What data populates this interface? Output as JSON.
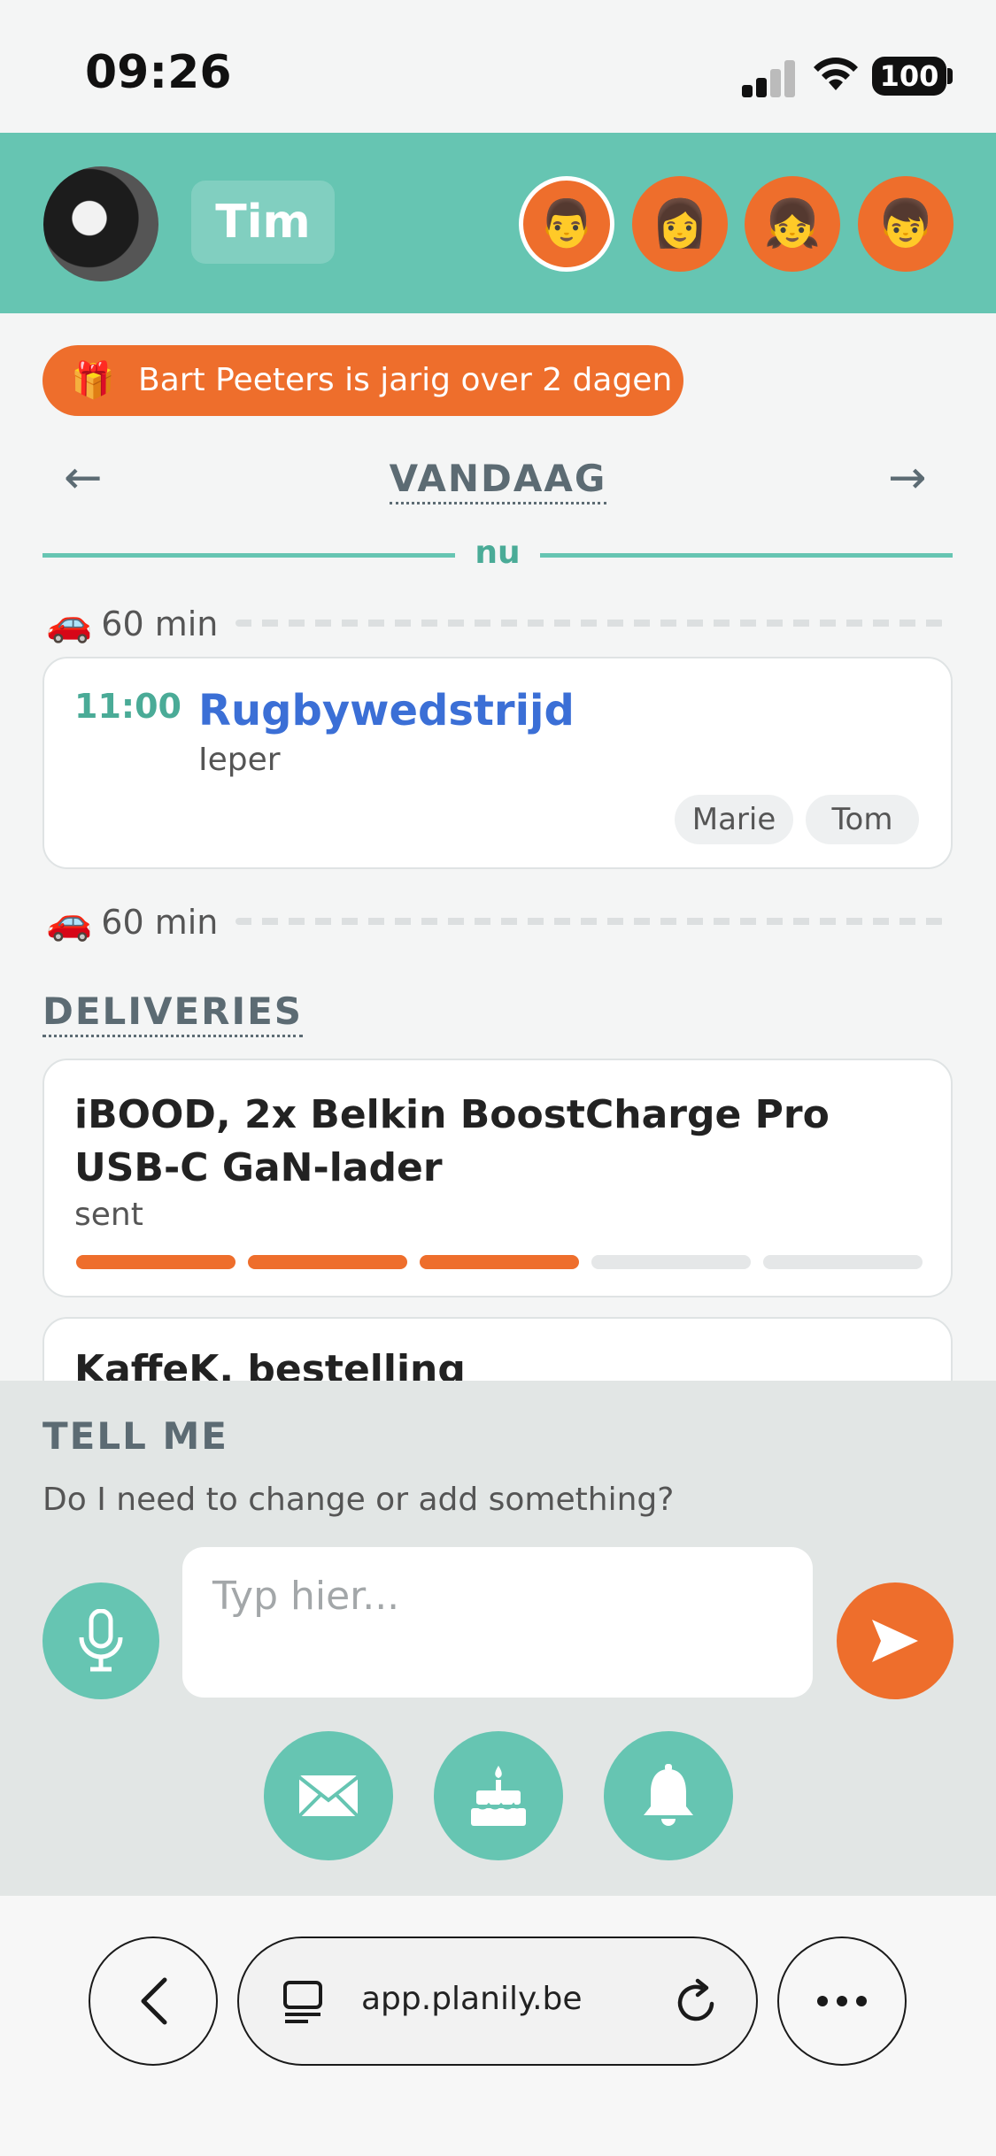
{
  "status_bar": {
    "time": "09:26",
    "battery": "100"
  },
  "header": {
    "user_name": "Tim",
    "members": [
      "👨",
      "👩",
      "👧",
      "👦"
    ]
  },
  "birthday_banner": {
    "icon": "🎁",
    "text": "Bart Peeters is jarig over 2 dagen"
  },
  "date_nav": {
    "prev": "←",
    "title": "VANDAAG",
    "next": "→"
  },
  "now_label": "nu",
  "travel": [
    {
      "icon": "🚗",
      "label": "60 min"
    },
    {
      "icon": "🚗",
      "label": "60 min"
    }
  ],
  "event": {
    "time": "11:00",
    "title": "Rugbywedstrijd",
    "location": "Ieper",
    "participants": [
      "Marie",
      "Tom"
    ]
  },
  "deliveries": {
    "title": "DELIVERIES",
    "items": [
      {
        "title": "iBOOD, 2x Belkin BoostCharge Pro USB-C GaN-lader",
        "status": "sent",
        "progress_steps_total": 5,
        "progress_steps_done": 3
      },
      {
        "title": "KaffeK, bestelling"
      }
    ]
  },
  "tell_me": {
    "title": "TELL ME",
    "subtitle": "Do I need to change or add something?",
    "input_placeholder": "Typ hier...",
    "quick_actions": [
      "mail-icon",
      "cake-icon",
      "bell-icon"
    ]
  },
  "browser": {
    "url": "app.planily.be"
  },
  "colors": {
    "teal": "#66c5b2",
    "orange": "#ee6e2c",
    "link_blue": "#3b6fd6"
  }
}
